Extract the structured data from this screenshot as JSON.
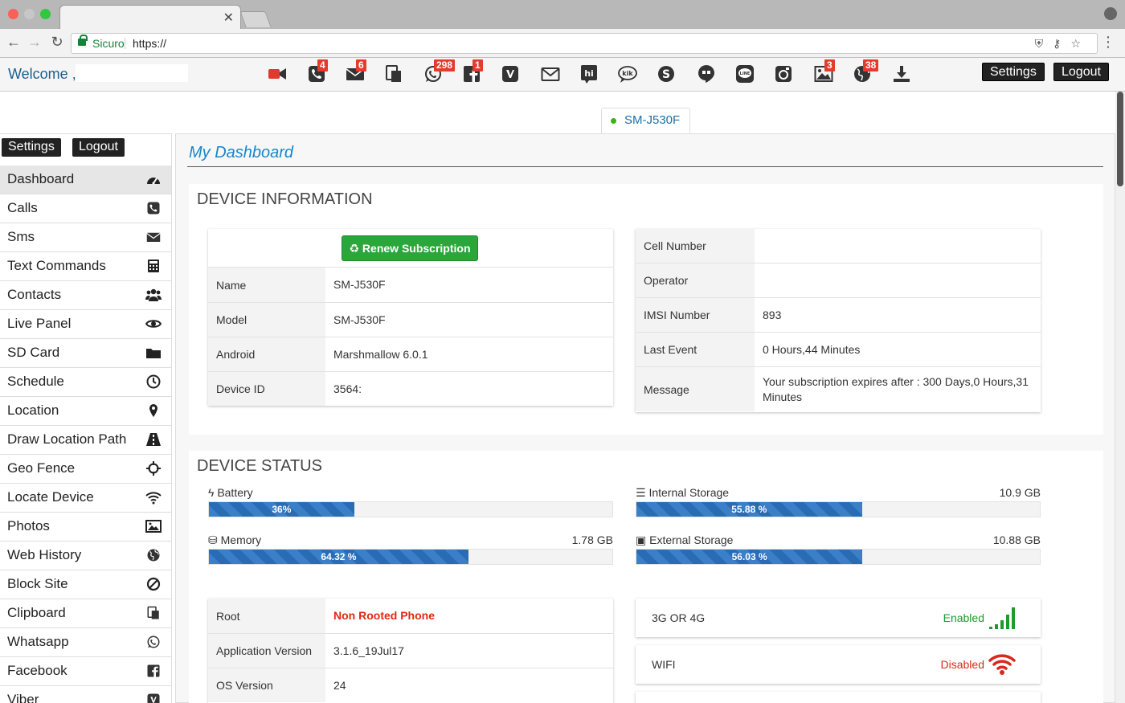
{
  "browser": {
    "secure_label": "Sicuro",
    "url": "https://"
  },
  "header": {
    "welcome": "Welcome ,",
    "settings_label": "Settings",
    "logout_label": "Logout",
    "icons": [
      {
        "name": "video-camera-icon",
        "badge": ""
      },
      {
        "name": "phone-icon",
        "badge": "4"
      },
      {
        "name": "envelope-icon",
        "badge": "6"
      },
      {
        "name": "clipboard-icon",
        "badge": ""
      },
      {
        "name": "whatsapp-icon",
        "badge": "298"
      },
      {
        "name": "facebook-icon",
        "badge": "1"
      },
      {
        "name": "viber-icon",
        "badge": ""
      },
      {
        "name": "email-outline-icon",
        "badge": ""
      },
      {
        "name": "hike-icon",
        "badge": ""
      },
      {
        "name": "kik-icon",
        "badge": ""
      },
      {
        "name": "skype-icon",
        "badge": ""
      },
      {
        "name": "hangouts-icon",
        "badge": ""
      },
      {
        "name": "line-icon",
        "badge": ""
      },
      {
        "name": "instagram-icon",
        "badge": ""
      },
      {
        "name": "photo-icon",
        "badge": "3"
      },
      {
        "name": "globe-icon",
        "badge": "38"
      },
      {
        "name": "download-icon",
        "badge": ""
      }
    ]
  },
  "device_tab": {
    "label": "SM-J530F"
  },
  "sidebar": {
    "settings_label": "Settings",
    "logout_label": "Logout",
    "items": [
      {
        "label": "Dashboard",
        "icon": "dashboard-icon",
        "active": true
      },
      {
        "label": "Calls",
        "icon": "phone-icon"
      },
      {
        "label": "Sms",
        "icon": "envelope-icon"
      },
      {
        "label": "Text Commands",
        "icon": "calculator-icon"
      },
      {
        "label": "Contacts",
        "icon": "users-icon"
      },
      {
        "label": "Live Panel",
        "icon": "eye-icon"
      },
      {
        "label": "SD Card",
        "icon": "folder-icon"
      },
      {
        "label": "Schedule",
        "icon": "clock-icon"
      },
      {
        "label": "Location",
        "icon": "map-pin-icon"
      },
      {
        "label": "Draw Location Path",
        "icon": "road-icon"
      },
      {
        "label": "Geo Fence",
        "icon": "crosshairs-icon"
      },
      {
        "label": "Locate Device",
        "icon": "wifi-icon"
      },
      {
        "label": "Photos",
        "icon": "image-icon"
      },
      {
        "label": "Web History",
        "icon": "globe-icon"
      },
      {
        "label": "Block Site",
        "icon": "ban-icon"
      },
      {
        "label": "Clipboard",
        "icon": "clipboard-icon"
      },
      {
        "label": "Whatsapp",
        "icon": "whatsapp-icon"
      },
      {
        "label": "Facebook",
        "icon": "facebook-icon"
      },
      {
        "label": "Viber",
        "icon": "viber-icon"
      }
    ]
  },
  "main": {
    "title": "My Dashboard",
    "device_info": {
      "title": "DEVICE INFORMATION",
      "renew_label": "♻ Renew Subscription",
      "left_rows": [
        {
          "label": "Name",
          "value": "SM-J530F"
        },
        {
          "label": "Model",
          "value": "SM-J530F"
        },
        {
          "label": "Android",
          "value": "Marshmallow 6.0.1"
        },
        {
          "label": "Device ID",
          "value": "3564:"
        }
      ],
      "right_rows": [
        {
          "label": "Cell Number",
          "value": ""
        },
        {
          "label": "Operator",
          "value": ""
        },
        {
          "label": "IMSI Number",
          "value": "893"
        },
        {
          "label": "Last Event",
          "value": "0 Hours,44 Minutes"
        },
        {
          "label": "Message",
          "value": "Your subscription expires after : 300 Days,0 Hours,31 Minutes"
        }
      ]
    },
    "device_status": {
      "title": "DEVICE STATUS",
      "bars": [
        {
          "label": "Battery",
          "icon": "bolt-icon",
          "right": "",
          "percent": 36,
          "percent_text": "36%"
        },
        {
          "label": "Internal Storage",
          "icon": "storage-icon",
          "right": "10.9 GB",
          "percent": 55.88,
          "percent_text": "55.88 %"
        },
        {
          "label": "Memory",
          "icon": "memory-icon",
          "right": "1.78 GB",
          "percent": 64.32,
          "percent_text": "64.32 %"
        },
        {
          "label": "External Storage",
          "icon": "floppy-icon",
          "right": "10.88 GB",
          "percent": 56.03,
          "percent_text": "56.03 %"
        }
      ],
      "detail_rows": [
        {
          "label": "Root",
          "value": "Non Rooted Phone"
        },
        {
          "label": "Application Version",
          "value": "3.1.6_19Jul17"
        },
        {
          "label": "OS Version",
          "value": "24"
        }
      ],
      "network": [
        {
          "name": "3G OR 4G",
          "status": "Enabled",
          "icon": "signal-bars-icon"
        },
        {
          "name": "WIFI",
          "status": "Disabled",
          "icon": "wifi-icon"
        }
      ]
    }
  },
  "colors": {
    "accent": "#1a86c8",
    "enabled": "#1f9a2e",
    "disabled": "#d9281c",
    "root_status": "#e0280f",
    "badge": "#e43b2c",
    "renew": "#2aa63a"
  }
}
